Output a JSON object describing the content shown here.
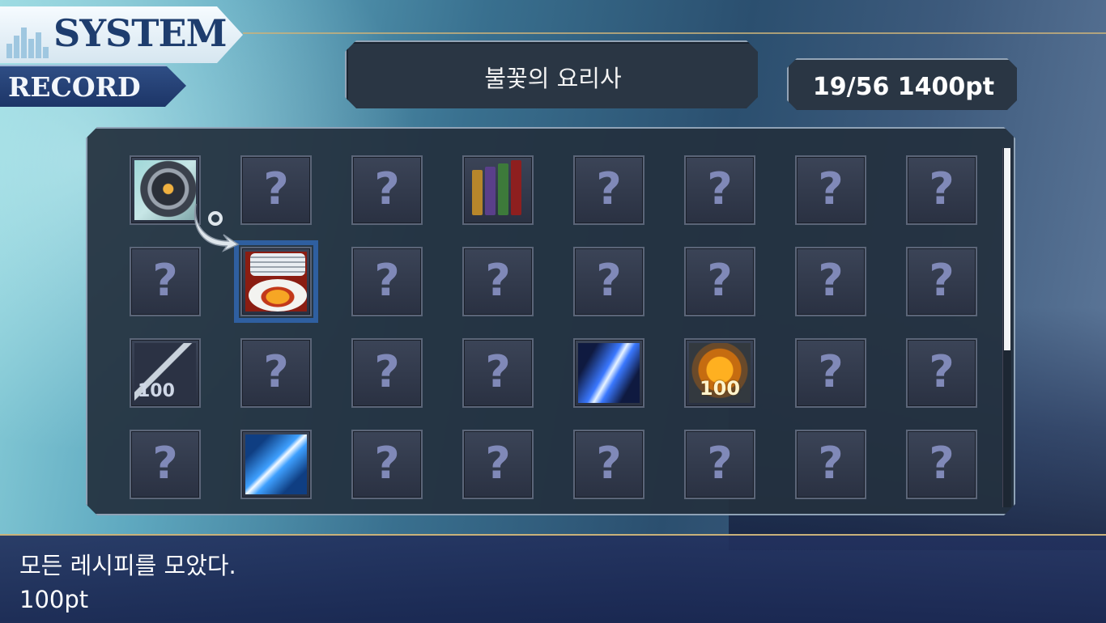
{
  "header": {
    "system_title": "SYSTEM",
    "record_title": "RECORD",
    "category": "불꽃의 요리사",
    "progress": "19/56 1400pt"
  },
  "grid": {
    "rows": [
      [
        "compass",
        "?",
        "?",
        "books",
        "?",
        "?",
        "?",
        "?"
      ],
      [
        "?",
        "dishes",
        "?",
        "?",
        "?",
        "?",
        "?",
        "?"
      ],
      [
        "sword-100",
        "?",
        "?",
        "?",
        "crystal",
        "gem-100",
        "?",
        "?"
      ],
      [
        "?",
        "slash",
        "?",
        "?",
        "?",
        "?",
        "?",
        "?"
      ]
    ],
    "unknown_label": "?",
    "selected": {
      "row": 1,
      "col": 1
    },
    "sword_level": "100",
    "gem_level": "100"
  },
  "footer": {
    "description": "모든 레시피를 모았다.",
    "points": "100pt"
  },
  "colors": {
    "panel": "#243040",
    "tile": "#343c4e",
    "question": "#8089b8",
    "selection": "#2f5fa0",
    "footer": "#22325e",
    "gold_line": "#c9b27a"
  }
}
